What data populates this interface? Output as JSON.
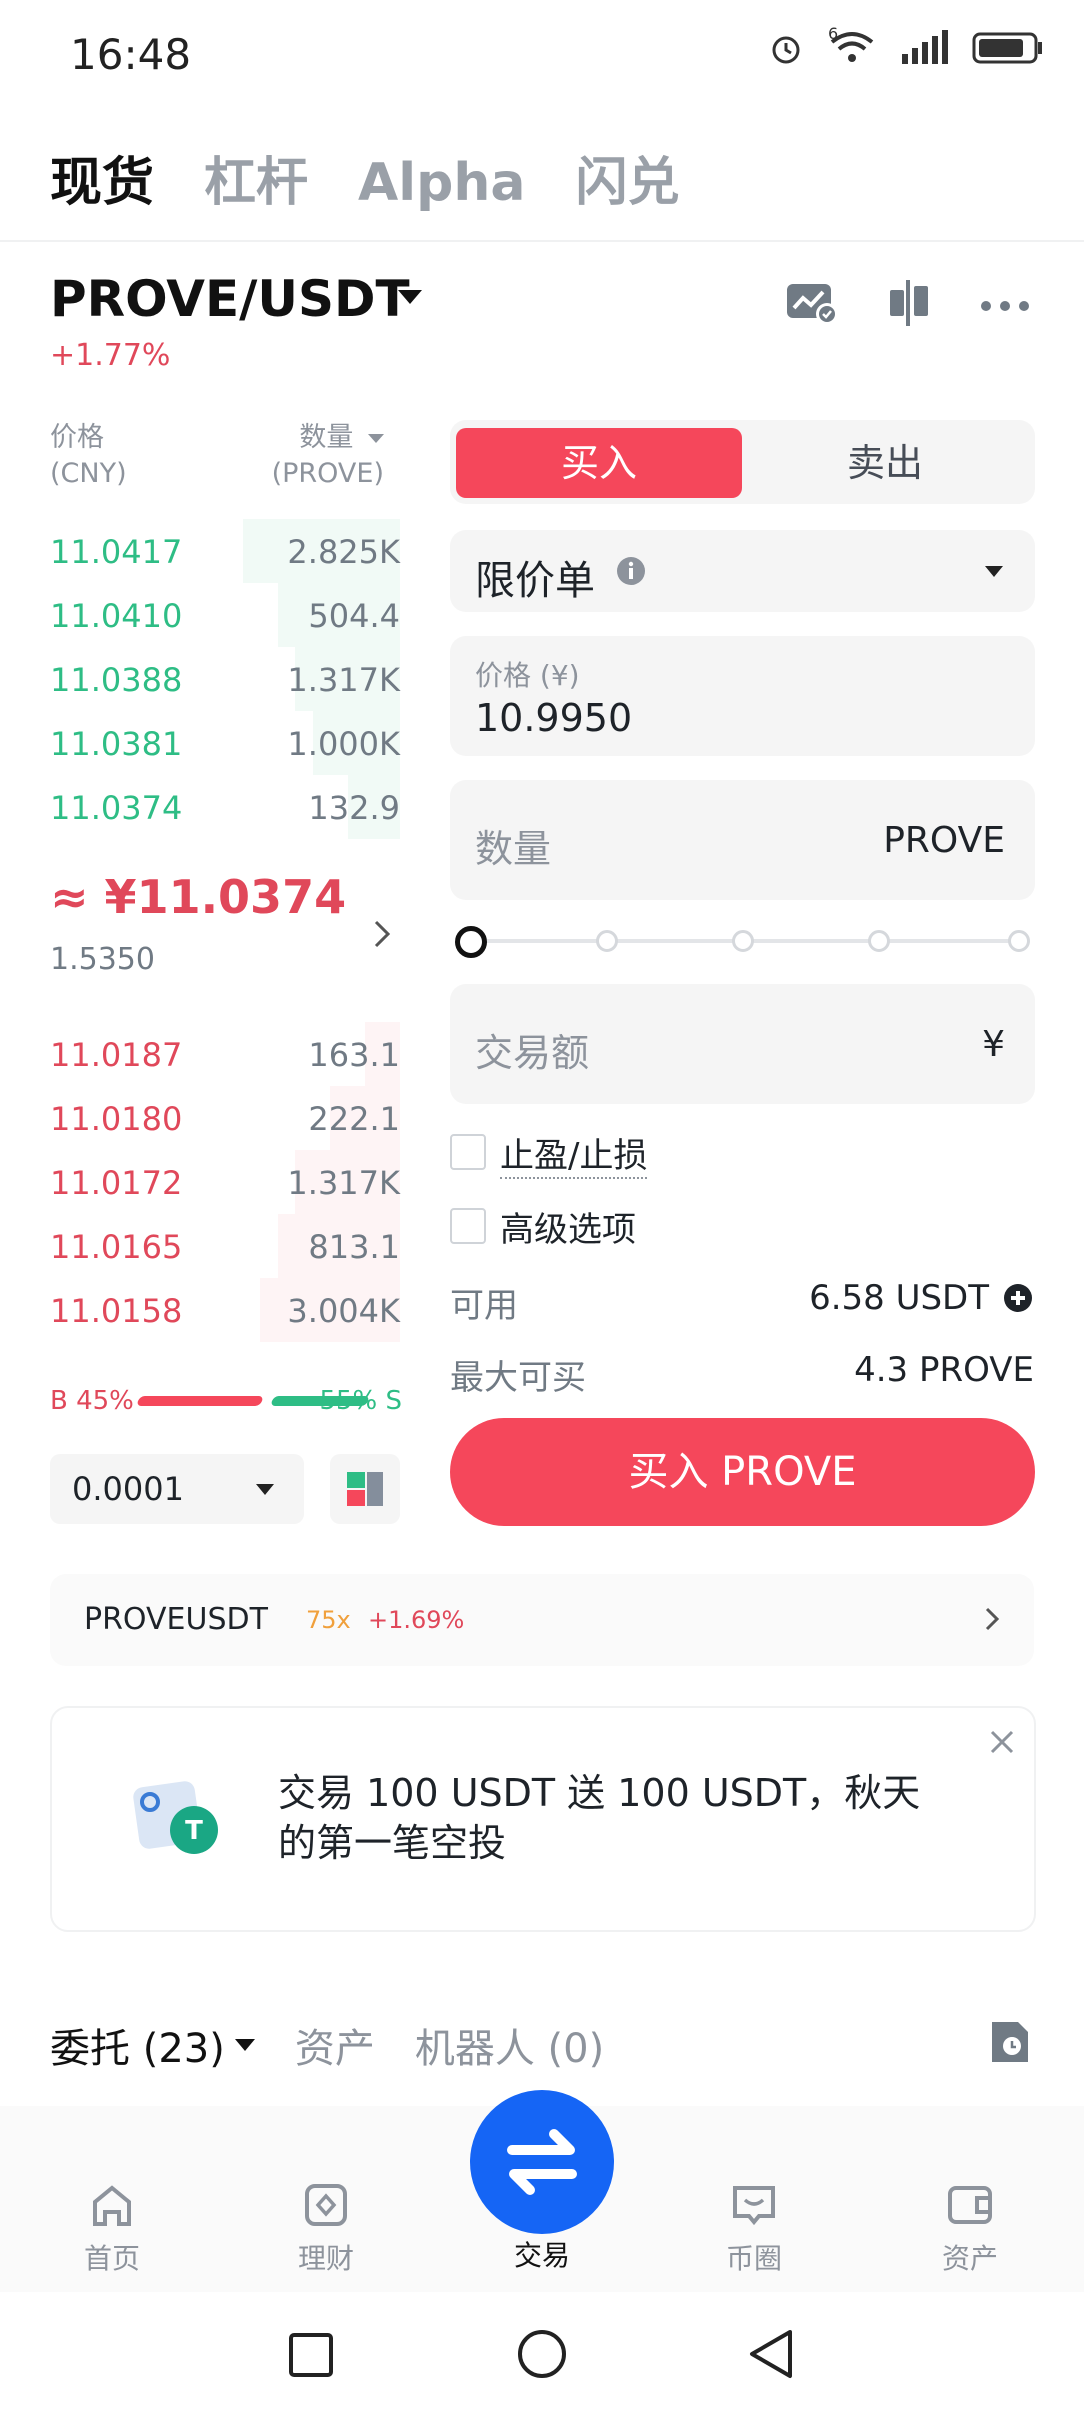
{
  "status": {
    "time": "16:48",
    "wifi_label": "6"
  },
  "top_tabs": [
    "现货",
    "杠杆",
    "Alpha",
    "闪兑"
  ],
  "pair": {
    "name": "PROVE/USDT",
    "change": "+1.77%"
  },
  "orderbook": {
    "price_header": "价格\n(CNY)",
    "qty_header": "数量",
    "qty_unit": "(PROVE)",
    "asks": [
      {
        "price": "11.0417",
        "qty": "2.825K",
        "depth": 0.45
      },
      {
        "price": "11.0410",
        "qty": "504.4",
        "depth": 0.35
      },
      {
        "price": "11.0388",
        "qty": "1.317K",
        "depth": 0.3
      },
      {
        "price": "11.0381",
        "qty": "1.000K",
        "depth": 0.25
      },
      {
        "price": "11.0374",
        "qty": "132.9",
        "depth": 0.15
      }
    ],
    "mid_price": "≈ ¥11.0374",
    "mid_sub": "1.5350",
    "bids": [
      {
        "price": "11.0187",
        "qty": "163.1",
        "depth": 0.1
      },
      {
        "price": "11.0180",
        "qty": "222.1",
        "depth": 0.2
      },
      {
        "price": "11.0172",
        "qty": "1.317K",
        "depth": 0.3
      },
      {
        "price": "11.0165",
        "qty": "813.1",
        "depth": 0.35
      },
      {
        "price": "11.0158",
        "qty": "3.004K",
        "depth": 0.4
      }
    ],
    "buy_ratio": "B 45%",
    "sell_ratio": "55% S",
    "step": "0.0001"
  },
  "form": {
    "buy_tab": "买入",
    "sell_tab": "卖出",
    "order_type": "限价单",
    "price_label": "价格 (¥)",
    "price_value": "10.9950",
    "qty_label": "数量",
    "qty_unit": "PROVE",
    "amount_label": "交易额",
    "amount_unit": "¥",
    "tp_sl": "止盈/止损",
    "advanced": "高级选项",
    "available_label": "可用",
    "available_value": "6.58 USDT",
    "maxbuy_label": "最大可买",
    "maxbuy_value": "4.3 PROVE",
    "buy_button": "买入 PROVE"
  },
  "futures": {
    "symbol": "PROVEUSDT",
    "leverage": "75x",
    "change": "+1.69%"
  },
  "promo": {
    "text": "交易 100 USDT 送 100 USDT，秋天的第一笔空投"
  },
  "orders": {
    "tabs": [
      "委托 (23)",
      "资产",
      "机器人 (0)"
    ]
  },
  "nav": [
    "首页",
    "理财",
    "交易",
    "币圈",
    "资产"
  ],
  "colors": {
    "buy": "#f5475b",
    "up": "#2ebd85",
    "down": "#e0485a",
    "brand": "#1565f5"
  }
}
